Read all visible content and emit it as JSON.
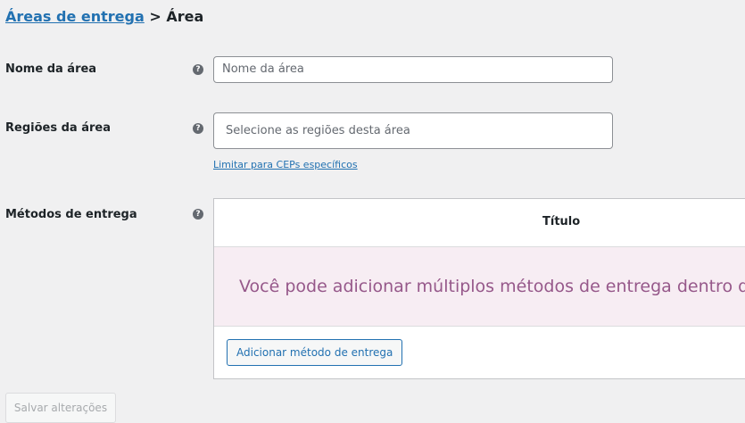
{
  "breadcrumb": {
    "link_label": "Áreas de entrega",
    "separator": ">",
    "current": "Área"
  },
  "rows": {
    "zone_name": {
      "label": "Nome da área",
      "placeholder": "Nome da área"
    },
    "zone_regions": {
      "label": "Regiões da área",
      "placeholder": "Selecione as regiões desta área",
      "limit_link": "Limitar para CEPs específicos"
    },
    "shipping_methods": {
      "label": "Métodos de entrega",
      "column_title": "Título",
      "empty_message": "Você pode adicionar múltiplos métodos de entrega dentro d",
      "add_button": "Adicionar método de entrega"
    }
  },
  "help_icon_glyph": "?",
  "save_button": "Salvar alterações",
  "colors": {
    "link": "#2271b1",
    "accent_purple": "#96588a",
    "blank_state_bg": "#f7edf3",
    "page_bg": "#f0f0f1"
  }
}
